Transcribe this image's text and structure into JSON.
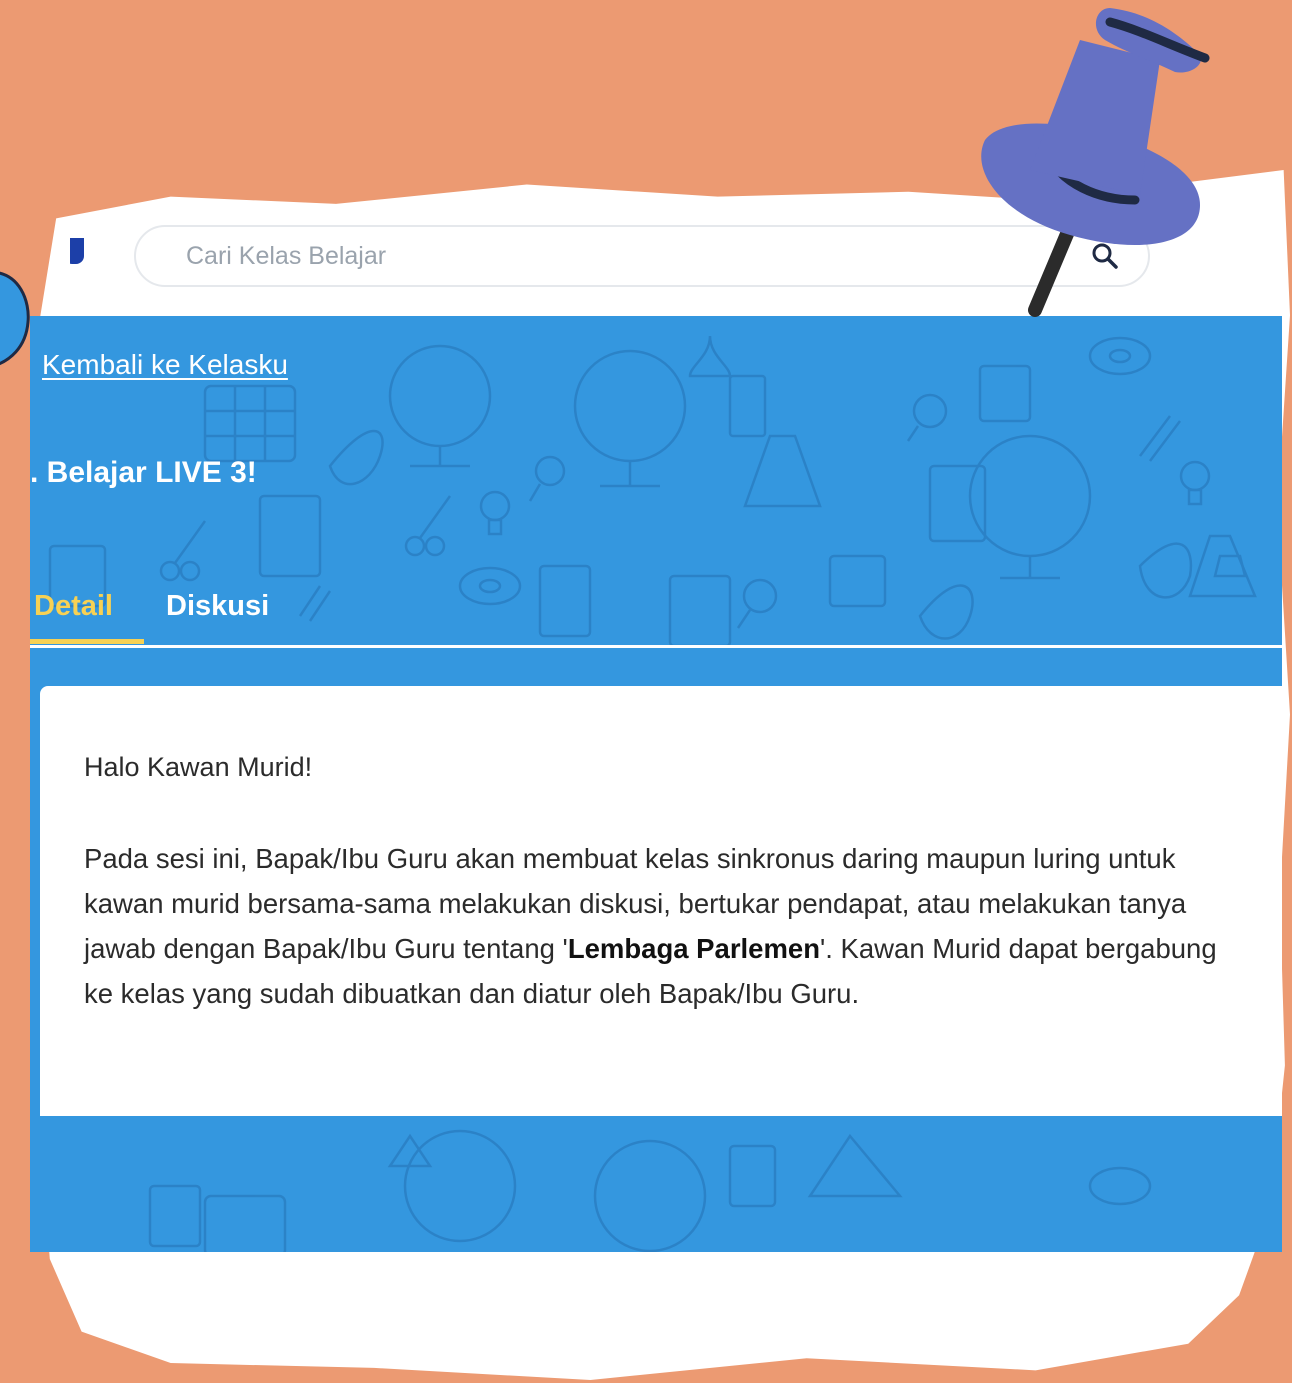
{
  "search": {
    "placeholder": "Cari Kelas Belajar"
  },
  "header": {
    "back_link": "Kembali ke Kelasku",
    "class_title": ". Belajar LIVE 3!"
  },
  "tabs": [
    {
      "label": "Detail",
      "active": true
    },
    {
      "label": "Diskusi",
      "active": false
    }
  ],
  "content": {
    "greeting": "Halo Kawan Murid!",
    "paragraph_part1": "Pada sesi ini, Bapak/Ibu Guru akan membuat kelas sinkronus daring maupun luring untuk kawan murid bersama-sama melakukan diskusi, bertukar pendapat, atau melakukan tanya jawab dengan Bapak/Ibu Guru tentang '",
    "paragraph_bold": "Lembaga Parlemen",
    "paragraph_part2": "'. Kawan Murid dapat bergabung ke kelas yang sudah dibuatkan dan diatur oleh Bapak/Ibu Guru."
  },
  "colors": {
    "background": "#ec9a72",
    "banner": "#3497df",
    "active_tab": "#f7d154",
    "pin": "#6571c4"
  },
  "icons": {
    "search": "search-icon",
    "pin": "push-pin-icon"
  }
}
